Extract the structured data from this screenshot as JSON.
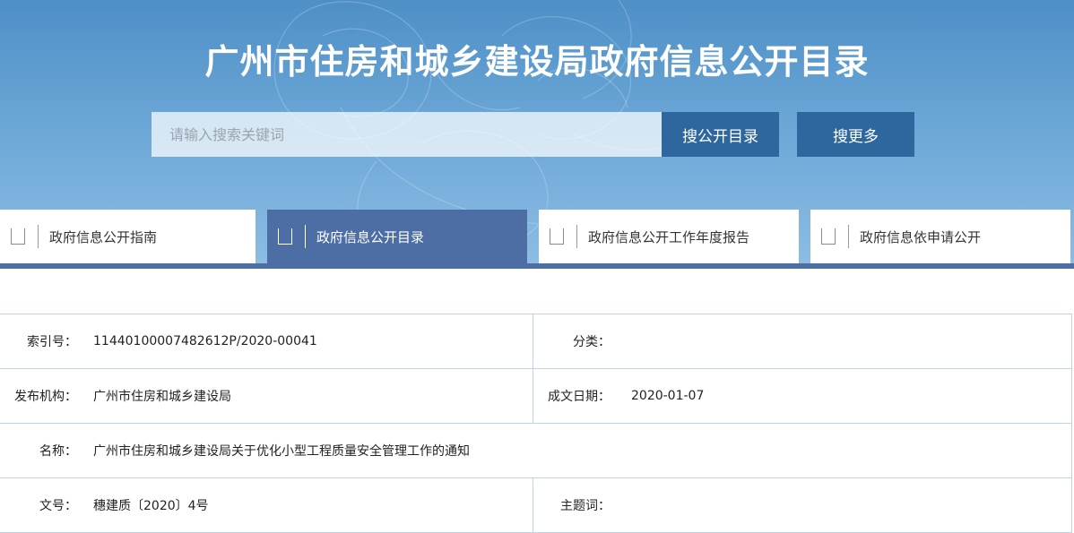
{
  "header": {
    "title": "广州市住房和城乡建设局政府信息公开目录"
  },
  "search": {
    "placeholder": "请输入搜索关键词",
    "value": "",
    "btn_catalog": "搜公开目录",
    "btn_more": "搜更多"
  },
  "tabs": [
    {
      "label": "政府信息公开指南",
      "active": false
    },
    {
      "label": "政府信息公开目录",
      "active": true
    },
    {
      "label": "政府信息公开工作年度报告",
      "active": false
    },
    {
      "label": "政府信息依申请公开",
      "active": false
    }
  ],
  "info": {
    "index_label": "索引号：",
    "index_value": "11440100007482612P/2020-00041",
    "category_label": "分类：",
    "category_value": "",
    "publisher_label": "发布机构：",
    "publisher_value": "广州市住房和城乡建设局",
    "date_label": "成文日期：",
    "date_value": "2020-01-07",
    "name_label": "名称：",
    "name_value": "广州市住房和城乡建设局关于优化小型工程质量安全管理工作的通知",
    "docno_label": "文号：",
    "docno_value": "穗建质〔2020〕4号",
    "subject_label": "主题词：",
    "subject_value": ""
  },
  "colors": {
    "banner_top": "#4e8fc6",
    "search_button": "#2d679e",
    "active_tab": "#4c6ea5",
    "table_border": "#bfd3e3"
  },
  "icons": {
    "tab_icon": "document-tab-icon",
    "banner_decoration": "flower-decoration-icon"
  }
}
